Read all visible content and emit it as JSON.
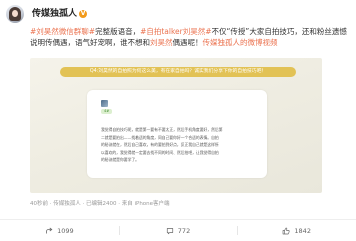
{
  "post": {
    "username": "传媒独孤人",
    "verified_badge": "V",
    "text_segments": [
      {
        "t": "#刘昊然微信群聊#",
        "link": true
      },
      {
        "t": "完整版语音，",
        "link": false
      },
      {
        "t": "#自拍talker刘昊然#",
        "link": true
      },
      {
        "t": "不仅“传授”大家自拍技巧，还和粉丝遗憾说明传偶遇，语气好宠啊，谁不想和",
        "link": false
      },
      {
        "t": "刘昊然",
        "link": true
      },
      {
        "t": "偶遇呢！",
        "link": false
      },
      {
        "t": "传媒独孤人的微博视频",
        "link": true
      }
    ],
    "card": {
      "question": "Q4:刘昊然的自拍照为何这么美，有在家自拍吗？诚实我们分享下你的自拍技巧吧！",
      "panel_badge": "4#",
      "panel_lines": [
        "我觉得自拍技巧呢，就是第一要有不要太正，然后手机角度要好，然后第",
        "二就是要拍出——找着适的角度，同自己要你好一个合适的表情。自拍",
        "的秘诀就在，然后自己喜欢，有的要拍到好点，反正我自己就是这样所",
        "以喜欢的，我觉得就一定要去找不同的时间、然后拍吧，让我觉得自拍",
        "的秘诀就是你要学了。"
      ]
    },
    "meta": "40秒前 · 传媒独孤人 · 已编辑2400 · 来自 iPhone客户端"
  },
  "footer": {
    "share": "1099",
    "comment": "772",
    "like": "1842"
  },
  "icons": {
    "share": "share-icon",
    "comment": "comment-icon",
    "like": "like-icon"
  }
}
